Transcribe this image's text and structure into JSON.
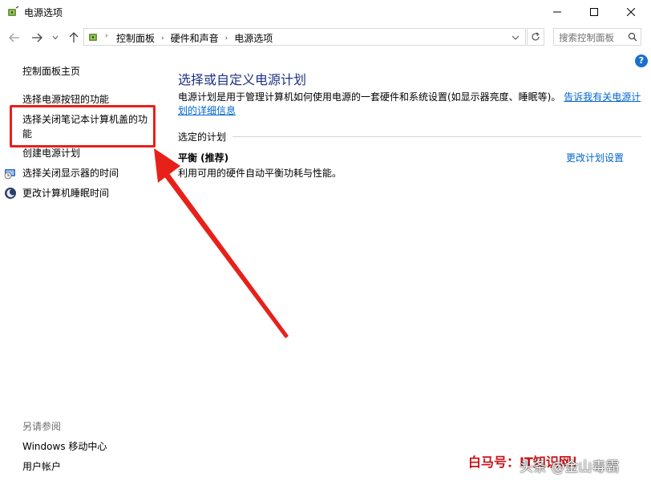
{
  "window": {
    "title": "电源选项",
    "icons": {
      "app": "power-options-icon",
      "minimize": "minimize-icon",
      "maximize": "maximize-icon",
      "close": "close-icon"
    }
  },
  "navigation": {
    "icons": {
      "back": "arrow-left-icon",
      "forward": "arrow-right-icon",
      "recent": "chevron-down-icon",
      "up": "arrow-up-icon",
      "refresh": "refresh-icon"
    },
    "breadcrumbs": [
      "控制面板",
      "硬件和声音",
      "电源选项"
    ],
    "search_placeholder": "搜索控制面板"
  },
  "help": {
    "label": "?",
    "icon": "help-icon"
  },
  "left_pane": {
    "home_link": "控制面板主页",
    "links": [
      "选择电源按钮的功能",
      "选择关闭笔记本计算机盖的功能",
      "创建电源计划",
      "选择关闭显示器的时间",
      "更改计算机睡眠时间"
    ],
    "see_also_title": "另请参阅",
    "see_also_links": [
      "Windows 移动中心",
      "用户帐户"
    ]
  },
  "main": {
    "title": "选择或自定义电源计划",
    "description": "电源计划是用于管理计算机如何使用电源的一套硬件和系统设置(如显示器亮度、睡眠等)。",
    "description_link": "告诉我有关电源计划的详细信息",
    "section_label": "选定的计划",
    "plan_name": "平衡 (推荐)",
    "plan_description": "利用可用的硬件自动平衡功耗与性能。",
    "change_plan_link": "更改计划设置"
  },
  "annotation_color": "#e8201a",
  "link_color": "#0066cc",
  "title_color": "#1e3287",
  "watermark": {
    "left": "白马号：IT知识网！",
    "right": "头条 @金山毒霸"
  }
}
